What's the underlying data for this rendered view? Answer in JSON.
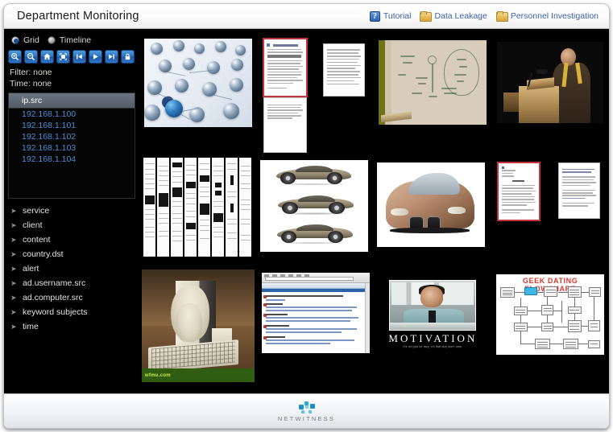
{
  "window": {
    "title": "Department Monitoring"
  },
  "header": {
    "links": [
      {
        "icon": "help-question-icon",
        "label": "Tutorial"
      },
      {
        "icon": "folder-icon",
        "label": "Data Leakage"
      },
      {
        "icon": "folder-icon",
        "label": "Personnel Investigation"
      }
    ],
    "link_color": "#3c63a8"
  },
  "sidebar": {
    "view_modes": [
      {
        "label": "Grid",
        "selected": true
      },
      {
        "label": "Timeline",
        "selected": false
      }
    ],
    "toolbar": [
      {
        "name": "zoom-in-icon",
        "title": "Zoom In"
      },
      {
        "name": "zoom-out-icon",
        "title": "Zoom Out"
      },
      {
        "name": "home-icon",
        "title": "Home"
      },
      {
        "name": "fit-screen-icon",
        "title": "Fit to Screen"
      },
      {
        "name": "skip-previous-icon",
        "title": "Previous"
      },
      {
        "name": "play-icon",
        "title": "Play"
      },
      {
        "name": "skip-next-icon",
        "title": "Next"
      },
      {
        "name": "lock-icon",
        "title": "Lock"
      }
    ],
    "filter_line": "Filter: none",
    "time_line": "Time: none",
    "value_box": {
      "header": "ip.src",
      "values": [
        "192.168.1.100",
        "192.168.1.101",
        "192.168.1.102",
        "192.168.1.103",
        "192.168.1.104"
      ],
      "value_color": "#4b8fd4"
    },
    "meta_keys": [
      "service",
      "client",
      "content",
      "country.dst",
      "alert",
      "ad.username.src",
      "ad.computer.src",
      "keyword subjects",
      "time"
    ]
  },
  "grid": {
    "selection_color": "#c2343a",
    "rows": [
      {
        "items": [
          {
            "name": "thumb-network-molecules",
            "type": "photo",
            "selected": false
          },
          {
            "name": "thumb-document-page-1",
            "type": "document",
            "selected": true
          },
          {
            "name": "thumb-document-page-2",
            "type": "document",
            "selected": false
          },
          {
            "name": "thumb-document-page-3",
            "type": "document",
            "selected": false
          },
          {
            "name": "thumb-whiteboard-photo",
            "type": "photo",
            "selected": false
          },
          {
            "name": "thumb-speaker-podium-photo",
            "type": "photo",
            "selected": false
          }
        ]
      },
      {
        "items": [
          {
            "name": "thumb-multicolumn-scan",
            "type": "document",
            "selected": false
          },
          {
            "name": "thumb-car-side-sketches",
            "type": "image",
            "selected": false
          },
          {
            "name": "thumb-car-front-render",
            "type": "image",
            "selected": false
          },
          {
            "name": "thumb-document-page-4",
            "type": "document",
            "selected": true
          },
          {
            "name": "thumb-document-page-5",
            "type": "document",
            "selected": false
          }
        ]
      },
      {
        "items": [
          {
            "name": "thumb-melted-computer-photo",
            "type": "photo",
            "selected": false,
            "watermark": "wfmu.com"
          },
          {
            "name": "thumb-browser-screenshot",
            "type": "screenshot",
            "selected": false
          },
          {
            "name": "thumb-motivation-poster",
            "type": "image",
            "selected": false,
            "caption": "MOTIVATION",
            "subcaption": "It's not just for lazy, it's that lazy don't care."
          },
          {
            "name": "thumb-geek-dating-flowchart",
            "type": "image",
            "selected": false,
            "caption": "GEEK DATING FLOWCHART"
          }
        ]
      }
    ]
  },
  "footer": {
    "brand": "NETWITNESS",
    "brand_color": "#2aa8e0"
  }
}
